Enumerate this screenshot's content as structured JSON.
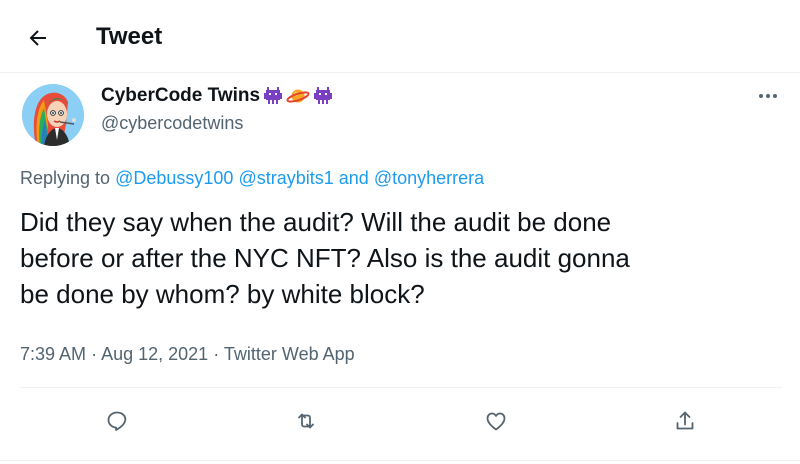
{
  "header": {
    "title": "Tweet",
    "back_icon": "arrow-left-icon"
  },
  "author": {
    "display_name": "CyberCode Twins",
    "handle": "@cybercodetwins",
    "name_emojis": [
      "alien-monster-purple-icon",
      "ringed-planet-icon",
      "alien-monster-purple-icon"
    ]
  },
  "reply": {
    "prefix": "Replying to",
    "mention_1": "@Debussy100",
    "mention_2": "@straybits1",
    "conjunction": "and",
    "mention_3": "@tonyherrera"
  },
  "tweet": {
    "lines": [
      "Did they say when the audit? Will the audit be done",
      "before or after the NYC NFT? Also is the audit gonna",
      "be done by whom? by white block?"
    ]
  },
  "meta": {
    "time": "7:39 AM",
    "separator": "·",
    "date": "Aug 12, 2021",
    "app": "Twitter Web App"
  },
  "actions": [
    "reply-icon",
    "retweet-icon",
    "like-icon",
    "share-icon"
  ],
  "colors": {
    "text": "#0f1419",
    "secondary": "#536471",
    "link": "#1d9bf0",
    "divider": "#eff3f4"
  }
}
